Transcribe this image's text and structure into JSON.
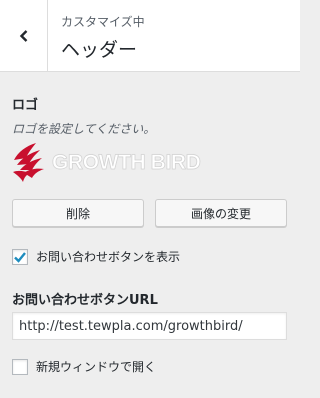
{
  "header": {
    "breadcrumb": "カスタマイズ中",
    "title": "ヘッダー"
  },
  "logo_section": {
    "label": "ロゴ",
    "description": "ロゴを設定してください。",
    "logo_text": "GROWTH BIRD",
    "logo_color": "#c8102e"
  },
  "buttons": {
    "remove_label": "削除",
    "change_image_label": "画像の変更"
  },
  "contact_button": {
    "show_label": "お問い合わせボタンを表示",
    "show_checked": true,
    "url_label": "お問い合わせボタンURL",
    "url_value": "http://test.tewpla.com/growthbird/",
    "new_window_label": "新規ウィンドウで開く",
    "new_window_checked": false
  },
  "colors": {
    "accent": "#1e8cbe",
    "panel_bg": "#eeeeee"
  }
}
